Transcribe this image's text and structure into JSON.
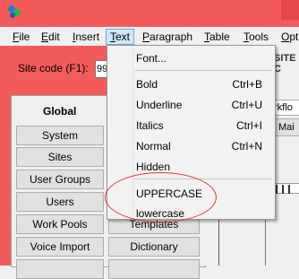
{
  "menubar": {
    "items": [
      {
        "label": "File",
        "underline": "F",
        "rest": "ile"
      },
      {
        "label": "Edit",
        "underline": "E",
        "rest": "dit"
      },
      {
        "label": "Insert",
        "underline": "I",
        "rest": "nsert"
      },
      {
        "label": "Text",
        "underline": "T",
        "rest": "ext"
      },
      {
        "label": "Paragraph",
        "underline": "P",
        "rest": "aragraph"
      },
      {
        "label": "Table",
        "underline": "T",
        "rest": "able"
      },
      {
        "label": "Tools",
        "underline": "T",
        "rest": "ools"
      },
      {
        "label": "Opt",
        "underline": "O",
        "rest": "pt"
      }
    ]
  },
  "site_code": {
    "label": "Site code (F1):",
    "value": "99"
  },
  "global_panel": {
    "title": "Global",
    "left_buttons": [
      "System",
      "Sites",
      "User Groups",
      "Users",
      "Work Pools",
      "Voice Import"
    ],
    "right_buttons": [
      "Templates",
      "Dictionary"
    ]
  },
  "right_pane": {
    "site_label": "SITE C",
    "workflow_tab": "orkflo",
    "main_button": "Mai"
  },
  "text_menu": {
    "font": "Font...",
    "bold": {
      "label": "Bold",
      "shortcut": "Ctrl+B"
    },
    "underline": {
      "label": "Underline",
      "shortcut": "Ctrl+U"
    },
    "italics": {
      "label": "Italics",
      "shortcut": "Ctrl+I"
    },
    "normal": {
      "label": "Normal",
      "shortcut": "Ctrl+N"
    },
    "hidden": {
      "label": "Hidden"
    },
    "uppercase": {
      "label": "UPPERCASE"
    },
    "lowercase": {
      "label": "lowercase"
    }
  },
  "colors": {
    "accent_red": "#f35b5b",
    "annotation_red": "#d33333",
    "menu_highlight": "#cce8ff"
  }
}
